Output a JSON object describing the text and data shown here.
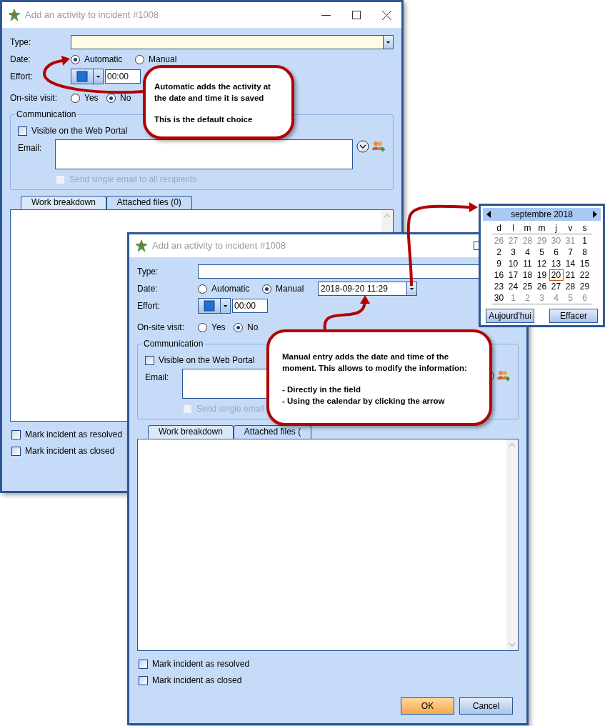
{
  "windows": [
    {
      "title": "Add an activity to incident #1008",
      "title_buttons": [
        {
          "kind": "minimize"
        },
        {
          "kind": "maximize"
        },
        {
          "kind": "close"
        }
      ],
      "type": {
        "label": "Type:",
        "focused": true
      },
      "date": {
        "label": "Date:",
        "options": [
          {
            "label": "Automatic",
            "selected": true
          },
          {
            "label": "Manual",
            "selected": false
          }
        ]
      },
      "effort": {
        "label": "Effort:",
        "value": "00:00"
      },
      "on_site_visit": {
        "label": "On-site visit:",
        "options": [
          {
            "label": "Yes",
            "selected": false
          },
          {
            "label": "No",
            "selected": true
          }
        ]
      },
      "communication": {
        "title": "Communication",
        "web_portal": {
          "label": "Visible on the Web Portal",
          "checked": false
        },
        "email": {
          "label": "Email:"
        },
        "single_email": {
          "label": "Send single email to all recipients",
          "checked": false,
          "disabled": true
        }
      },
      "tabs": [
        {
          "label": "Work breakdown",
          "selected": true
        },
        {
          "label": "Attached files (0)",
          "selected": false
        }
      ],
      "checkboxes": [
        {
          "label": "Mark incident as resolved",
          "checked": false
        },
        {
          "label": "Mark incident as closed",
          "checked": false
        }
      ]
    },
    {
      "title": "Add an activity to incident #1008",
      "title_buttons": [
        {
          "kind": "maximize"
        }
      ],
      "type": {
        "label": "Type:",
        "focused": false
      },
      "date": {
        "label": "Date:",
        "options": [
          {
            "label": "Automatic",
            "selected": false
          },
          {
            "label": "Manual",
            "selected": true
          }
        ],
        "value": "2018-09-20 11:29"
      },
      "effort": {
        "label": "Effort:",
        "value": "00:00"
      },
      "on_site_visit": {
        "label": "On-site visit:",
        "options": [
          {
            "label": "Yes",
            "selected": false
          },
          {
            "label": "No",
            "selected": true
          }
        ]
      },
      "communication": {
        "title": "Communication",
        "web_portal": {
          "label": "Visible on the Web Portal",
          "checked": false
        },
        "email": {
          "label": "Email:"
        },
        "single_email": {
          "label": "Send single email",
          "checked": false,
          "disabled": true
        }
      },
      "tabs": [
        {
          "label": "Work breakdown",
          "selected": true
        },
        {
          "label": "Attached files (",
          "selected": false
        }
      ],
      "checkboxes": [
        {
          "label": "Mark incident as resolved",
          "checked": false
        },
        {
          "label": "Mark incident as closed",
          "checked": false
        }
      ],
      "buttons": [
        {
          "label": "OK",
          "default": true
        },
        {
          "label": "Cancel",
          "default": false
        }
      ]
    }
  ],
  "calendar": {
    "month": "septembre 2018",
    "weekdays": [
      "d",
      "l",
      "m",
      "m",
      "j",
      "v",
      "s"
    ],
    "days": [
      {
        "label": "26",
        "other_month": true,
        "selected": false
      },
      {
        "label": "27",
        "other_month": true,
        "selected": false
      },
      {
        "label": "28",
        "other_month": true,
        "selected": false
      },
      {
        "label": "29",
        "other_month": true,
        "selected": false
      },
      {
        "label": "30",
        "other_month": true,
        "selected": false
      },
      {
        "label": "31",
        "other_month": true,
        "selected": false
      },
      {
        "label": "1",
        "other_month": false,
        "selected": false
      },
      {
        "label": "2",
        "other_month": false,
        "selected": false
      },
      {
        "label": "3",
        "other_month": false,
        "selected": false
      },
      {
        "label": "4",
        "other_month": false,
        "selected": false
      },
      {
        "label": "5",
        "other_month": false,
        "selected": false
      },
      {
        "label": "6",
        "other_month": false,
        "selected": false
      },
      {
        "label": "7",
        "other_month": false,
        "selected": false
      },
      {
        "label": "8",
        "other_month": false,
        "selected": false
      },
      {
        "label": "9",
        "other_month": false,
        "selected": false
      },
      {
        "label": "10",
        "other_month": false,
        "selected": false
      },
      {
        "label": "11",
        "other_month": false,
        "selected": false
      },
      {
        "label": "12",
        "other_month": false,
        "selected": false
      },
      {
        "label": "13",
        "other_month": false,
        "selected": false
      },
      {
        "label": "14",
        "other_month": false,
        "selected": false
      },
      {
        "label": "15",
        "other_month": false,
        "selected": false
      },
      {
        "label": "16",
        "other_month": false,
        "selected": false
      },
      {
        "label": "17",
        "other_month": false,
        "selected": false
      },
      {
        "label": "18",
        "other_month": false,
        "selected": false
      },
      {
        "label": "19",
        "other_month": false,
        "selected": false
      },
      {
        "label": "20",
        "other_month": false,
        "selected": true
      },
      {
        "label": "21",
        "other_month": false,
        "selected": false
      },
      {
        "label": "22",
        "other_month": false,
        "selected": false
      },
      {
        "label": "23",
        "other_month": false,
        "selected": false
      },
      {
        "label": "24",
        "other_month": false,
        "selected": false
      },
      {
        "label": "25",
        "other_month": false,
        "selected": false
      },
      {
        "label": "26",
        "other_month": false,
        "selected": false
      },
      {
        "label": "27",
        "other_month": false,
        "selected": false
      },
      {
        "label": "28",
        "other_month": false,
        "selected": false
      },
      {
        "label": "29",
        "other_month": false,
        "selected": false
      },
      {
        "label": "30",
        "other_month": false,
        "selected": false
      },
      {
        "label": "1",
        "other_month": true,
        "selected": false
      },
      {
        "label": "2",
        "other_month": true,
        "selected": false
      },
      {
        "label": "3",
        "other_month": true,
        "selected": false
      },
      {
        "label": "4",
        "other_month": true,
        "selected": false
      },
      {
        "label": "5",
        "other_month": true,
        "selected": false
      },
      {
        "label": "6",
        "other_month": true,
        "selected": false
      }
    ],
    "buttons": [
      "Aujourd'hui",
      "Effacer"
    ]
  },
  "callouts": [
    {
      "paragraphs": [
        [
          "Automatic adds the activity at the date and time it is saved"
        ],
        [
          "This is the default choice"
        ]
      ]
    },
    {
      "paragraphs": [
        [
          "Manual entry adds the date and time of the moment. This allows to modify the information:"
        ],
        [
          "- Directly in the field",
          "- Using the calendar by clicking the arrow"
        ]
      ]
    }
  ]
}
